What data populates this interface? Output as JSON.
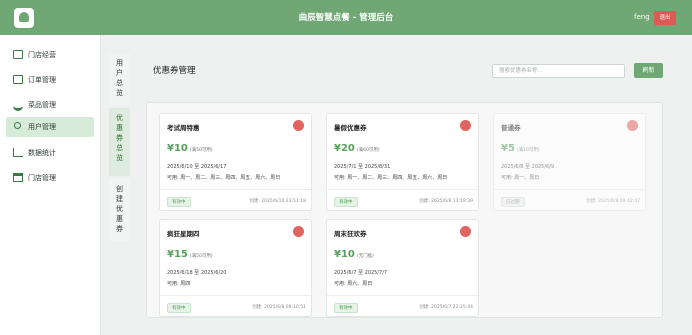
{
  "header": {
    "title": "曲辰智慧点餐 - 管理后台",
    "user": "feng",
    "logout_label": "退出",
    "accent": "#6fa874"
  },
  "sidebar": {
    "items": [
      {
        "label": "门店经营",
        "icon": "store-icon"
      },
      {
        "label": "订单管理",
        "icon": "order-list-icon"
      },
      {
        "label": "菜品管理",
        "icon": "dish-icon"
      },
      {
        "label": "用户管理",
        "icon": "user-icon",
        "active": true
      },
      {
        "label": "数据统计",
        "icon": "bar-chart-icon"
      },
      {
        "label": "门店管理",
        "icon": "shop-icon"
      }
    ]
  },
  "subtabs": [
    {
      "label": "用户总览"
    },
    {
      "label": "优惠券总览",
      "active": true
    },
    {
      "label": "创建优惠券"
    }
  ],
  "main": {
    "title": "优惠券管理",
    "search_placeholder": "搜索优惠券名称...",
    "refresh_label": "刷新"
  },
  "coupons": [
    {
      "name": "考试周特惠",
      "amount": "¥10",
      "condition": "(满50可用)",
      "dates": "2025/6/10 至 2025/6/17",
      "days": "可用: 周一、周二、周三、周四、周五、周六、周日",
      "status": "有效中",
      "created": "创建: 2025/6/10 23:51:18",
      "disabled": false
    },
    {
      "name": "暑假优惠券",
      "amount": "¥20",
      "condition": "(满60可用)",
      "dates": "2025/7/1 至 2025/8/31",
      "days": "可用: 周一、周二、周三、周四、周五、周六、周日",
      "status": "有效中",
      "created": "创建: 2025/6/8 11:19:39",
      "disabled": false
    },
    {
      "name": "普通券",
      "amount": "¥5",
      "condition": "(满10可用)",
      "dates": "2025/6/8 至 2025/6/9",
      "days": "可用: 周一、周日",
      "status": "已过期",
      "created": "创建: 2025/6/8 09:42:47",
      "disabled": true
    },
    {
      "name": "疯狂星期四",
      "amount": "¥15",
      "condition": "(满50可用)",
      "dates": "2025/6/18 至 2025/6/20",
      "days": "可用: 周四",
      "status": "有效中",
      "created": "创建: 2025/6/8 09:10:51",
      "disabled": false
    },
    {
      "name": "周末狂欢券",
      "amount": "¥10",
      "condition": "(无门槛)",
      "dates": "2025/6/7 至 2025/7/7",
      "days": "可用: 周六、周日",
      "status": "有效中",
      "created": "创建: 2025/6/7 22:25:44",
      "disabled": false
    }
  ]
}
